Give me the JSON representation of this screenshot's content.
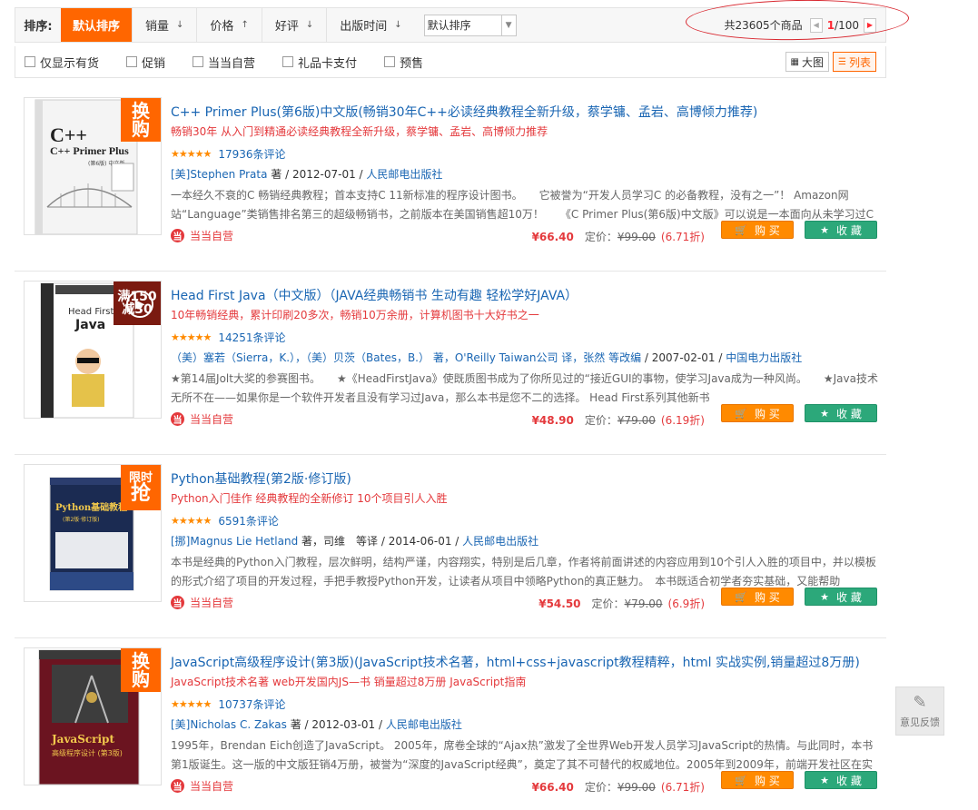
{
  "sortbar": {
    "label": "排序:",
    "options": [
      {
        "label": "默认排序",
        "arrow": ""
      },
      {
        "label": "销量",
        "arrow": "↓"
      },
      {
        "label": "价格",
        "arrow": "↑"
      },
      {
        "label": "好评",
        "arrow": "↓"
      },
      {
        "label": "出版时间",
        "arrow": "↓"
      }
    ],
    "select_value": "默认排序",
    "total": "共23605个商品",
    "page_current": "1",
    "page_total": "/100"
  },
  "filters": [
    "仅显示有货",
    "促销",
    "当当自营",
    "礼品卡支付",
    "预售"
  ],
  "views": {
    "grid": "大图",
    "list": "列表"
  },
  "products": [
    {
      "title": "C++ Primer Plus(第6版)中文版(畅销30年C++必读经典教程全新升级，蔡学镛、孟岩、高博倾力推荐)",
      "subtitle": "畅销30年 从入门到精通必读经典教程全新升级，蔡学镛、孟岩、高博倾力推荐",
      "stars": "★★★★★",
      "reviews": "17936条评论",
      "author": "[美]Stephen Prata",
      "author_suffix": " 著",
      "date": " / 2012-07-01 / ",
      "publisher": "人民邮电出版社",
      "desc": "一本经久不衰的C 畅销经典教程；首本支持C 11新标准的程序设计图书。　　它被誉为“开发人员学习C 的必备教程，没有之一”！ Amazon网站“Language”类销售排名第三的超级畅销书，之前版本在美国销售超10万！　　《C Primer Plus(第6版)中文版》可以说是一本面向从未学习过C语言",
      "shop": "当当自营",
      "price": "¥66.40",
      "list_label": "定价：",
      "list_price": "¥99.00",
      "discount": "(6.71折)",
      "badge": [
        "换",
        "购"
      ],
      "cover_title": "C++ Primer Plus",
      "cover_sub": "(第6版) 中文版"
    },
    {
      "title": "Head First Java（中文版）（JAVA经典畅销书 生动有趣 轻松学好JAVA）",
      "subtitle": "10年畅销经典，累计印刷20多次，畅销10万余册，计算机图书十大好书之一",
      "stars": "★★★★★",
      "reviews": "14251条评论",
      "author": "（美）塞若（Sierra，K.），（美）贝茨（Bates，B.） 著，O'Reilly Taiwan公司 译，张然 等改编",
      "author_suffix": "",
      "date": " / 2007-02-01 / ",
      "publisher": "中国电力出版社",
      "desc": "★第14届Jolt大奖的参赛图书。　　★《HeadFirstJava》使既质图书成为了你所见过的“接近GUI的事物，使学习Java成为一种风尚。　　★Java技术无所不在——如果你是一个软件开发者且没有学习过Java，那么本书是您不二的选择。 Head First系列其他新书",
      "shop": "当当自营",
      "price": "¥48.90",
      "list_label": "定价：",
      "list_price": "¥79.00",
      "discount": "(6.19折)",
      "badge": [
        "满150",
        "减30"
      ],
      "cover_title": "Head First Java",
      "cover_sub": "(中文版)"
    },
    {
      "title": "Python基础教程(第2版·修订版)",
      "subtitle": "Python入门佳作 经典教程的全新修订 10个项目引人入胜",
      "stars": "★★★★★",
      "reviews": "6591条评论",
      "author": "[挪]Magnus Lie Hetland",
      "author_suffix": " 著，司维　等译",
      "date": " / 2014-06-01 / ",
      "publisher": "人民邮电出版社",
      "desc": "本书是经典的Python入门教程，层次鲜明，结构严谨，内容翔实，特别是后几章，作者将前面讲述的内容应用到10个引人入胜的项目中，并以模板的形式介绍了项目的开发过程，手把手教授Python开发，让读者从项目中领略Python的真正魅力。　本书既适合初学者夯实基础，又能帮助",
      "shop": "当当自营",
      "price": "¥54.50",
      "list_label": "定价：",
      "list_price": "¥79.00",
      "discount": "(6.9折)",
      "badge": [
        "限时",
        "抢"
      ],
      "cover_title": "Python基础教程",
      "cover_sub": "(第2版·修订版)"
    },
    {
      "title": "JavaScript高级程序设计(第3版)(JavaScript技术名著，html+css+javascript教程精粹，html 实战实例,销量超过8万册)",
      "subtitle": "JavaScript技术名著 web开发国内JS—书 销量超过8万册 JavaScript指南",
      "stars": "★★★★★",
      "reviews": "10737条评论",
      "author": "[美]Nicholas C. Zakas",
      "author_suffix": " 著",
      "date": " / 2012-03-01 / ",
      "publisher": "人民邮电出版社",
      "desc": "1995年，Brendan Eich创造了JavaScript。 2005年，席卷全球的“Ajax热”激发了全世界Web开发人员学习JavaScript的热情。与此同时，本书第1版诞生。这一版的中文版狂销4万册，被誉为“深度的JavaScript经典”，奠定了其不可替代的权威地位。2005年到2009年，前端开发社区在实践中充分",
      "shop": "当当自营",
      "price": "¥66.40",
      "list_label": "定价：",
      "list_price": "¥99.00",
      "discount": "(6.71折)",
      "badge": [
        "换",
        "购"
      ],
      "cover_title": "JavaScript",
      "cover_sub": "高级程序设计 (第3版)"
    }
  ],
  "buttons": {
    "buy": "购 买",
    "fav": "收 藏"
  },
  "feedback": "意见反馈",
  "colors": {
    "accent": "#ff6600",
    "price": "#e4393c",
    "link": "#1a66b3",
    "buy": "#ff8a00",
    "fav": "#2ca87a"
  }
}
